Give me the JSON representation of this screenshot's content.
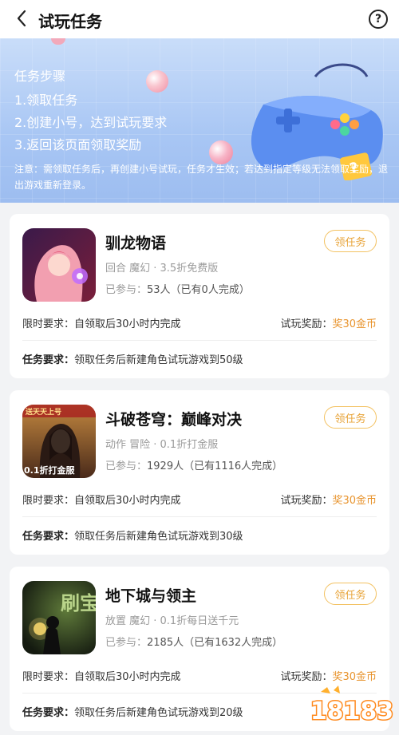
{
  "header": {
    "title": "试玩任务",
    "help_label": "?"
  },
  "banner": {
    "steps_title": "任务步骤",
    "steps": [
      "1.领取任务",
      "2.创建小号，达到试玩要求",
      "3.返回该页面领取奖励"
    ],
    "notice": "注意：需领取任务后，再创建小号试玩，任务才生效；若达到指定等级无法领取奖励，退出游戏重新登录。"
  },
  "labels": {
    "joined_prefix": "已参与：",
    "time_requirement": "限时要求：",
    "trial_reward": "试玩奖励：",
    "task_requirement": "任务要求：",
    "claim_button": "领任务"
  },
  "games": [
    {
      "name": "驯龙物语",
      "tags": "回合  魔幻 ·  3.5折免费版",
      "joined": "53人（已有0人完成）",
      "time_req": "自领取后30小时内完成",
      "reward": "奖30金币",
      "task_req": "领取任务后新建角色试玩游戏到50级"
    },
    {
      "name": "斗破苍穹：巅峰对决",
      "tags": "动作  冒险 ·  0.1折打金服",
      "joined": "1929人（已有1116人完成）",
      "time_req": "自领取后30小时内完成",
      "reward": "奖30金币",
      "task_req": "领取任务后新建角色试玩游戏到30级",
      "icon_text_top": "送天天上号",
      "icon_text_bottom": "0.1折打金服"
    },
    {
      "name": "地下城与领主",
      "tags": "放置  魔幻 ·  0.1折每日送千元",
      "joined": "2185人（已有1632人完成）",
      "time_req": "自领取后30小时内完成",
      "reward": "奖30金币",
      "task_req": "领取任务后新建角色试玩游戏到20级",
      "icon_text": "刷宝"
    }
  ],
  "watermark": {
    "text": "18183"
  },
  "colors": {
    "accent": "#e8932c",
    "claim_border": "#f3c262",
    "banner_top": "#c9ddf9",
    "banner_bottom": "#9dbdf0"
  }
}
